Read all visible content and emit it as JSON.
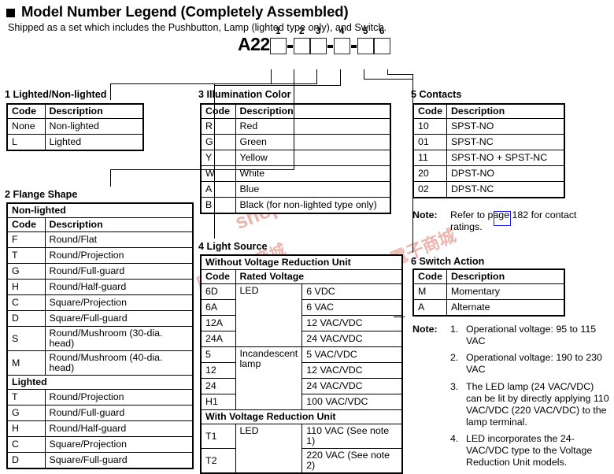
{
  "header": {
    "title": "Model Number Legend (Completely Assembled)",
    "subtitle": "Shipped as a set which includes the Pushbutton, Lamp (lighted type only), and Switch."
  },
  "model_number": {
    "prefix": "A22",
    "dash": "-",
    "positions": [
      "1",
      "2",
      "3",
      "4",
      "5",
      "6"
    ]
  },
  "watermark": {
    "line1": "shop.cpu.com.tw",
    "line2": "shop.cpu.com.tw",
    "line3": "康華電子商城",
    "line4": "康華電子商城"
  },
  "sections": {
    "s1": {
      "title": "1 Lighted/Non-lighted",
      "headers": [
        "Code",
        "Description"
      ],
      "rows": [
        [
          "None",
          "Non-lighted"
        ],
        [
          "L",
          "Lighted"
        ]
      ]
    },
    "s2": {
      "title": "2 Flange Shape",
      "group1": "Non-lighted",
      "headers": [
        "Code",
        "Description"
      ],
      "rows_nonlighted": [
        [
          "F",
          "Round/Flat"
        ],
        [
          "T",
          "Round/Projection"
        ],
        [
          "G",
          "Round/Full-guard"
        ],
        [
          "H",
          "Round/Half-guard"
        ],
        [
          "C",
          "Square/Projection"
        ],
        [
          "D",
          "Square/Full-guard"
        ],
        [
          "S",
          "Round/Mushroom (30-dia. head)"
        ],
        [
          "M",
          "Round/Mushroom (40-dia. head)"
        ]
      ],
      "group2": "Lighted",
      "rows_lighted": [
        [
          "T",
          "Round/Projection"
        ],
        [
          "G",
          "Round/Full-guard"
        ],
        [
          "H",
          "Round/Half-guard"
        ],
        [
          "C",
          "Square/Projection"
        ],
        [
          "D",
          "Square/Full-guard"
        ]
      ]
    },
    "s3": {
      "title": "3 Illumination Color",
      "headers": [
        "Code",
        "Description"
      ],
      "rows": [
        [
          "R",
          "Red"
        ],
        [
          "G",
          "Green"
        ],
        [
          "Y",
          "Yellow"
        ],
        [
          "W",
          "White"
        ],
        [
          "A",
          "Blue"
        ],
        [
          "B",
          "Black (for non-lighted type only)"
        ]
      ]
    },
    "s4": {
      "title": "4 Light Source",
      "group1": "Without Voltage Reduction Unit",
      "headers": [
        "Code",
        "Rated Voltage"
      ],
      "rows_without": [
        [
          "6D",
          "LED",
          "6 VDC"
        ],
        [
          "6A",
          "",
          "6 VAC"
        ],
        [
          "12A",
          "",
          "12 VAC/VDC"
        ],
        [
          "24A",
          "",
          "24 VAC/VDC"
        ],
        [
          "5",
          "Incandescent lamp",
          "5 VAC/VDC"
        ],
        [
          "12",
          "",
          "12 VAC/VDC"
        ],
        [
          "24",
          "",
          "24 VAC/VDC"
        ],
        [
          "H1",
          "",
          "100 VAC/VDC"
        ]
      ],
      "group2": "With Voltage Reduction Unit",
      "rows_with": [
        [
          "T1",
          "LED",
          "110 VAC (See note 1)"
        ],
        [
          "T2",
          "",
          "220 VAC (See note 2)"
        ]
      ]
    },
    "s5": {
      "title": "5 Contacts",
      "headers": [
        "Code",
        "Description"
      ],
      "rows": [
        [
          "10",
          "SPST-NO"
        ],
        [
          "01",
          "SPST-NC"
        ],
        [
          "11",
          "SPST-NO + SPST-NC"
        ],
        [
          "20",
          "DPST-NO"
        ],
        [
          "02",
          "DPST-NC"
        ]
      ],
      "note_label": "Note:",
      "note_text": "Refer to page 182 for contact ratings."
    },
    "s6": {
      "title": "6 Switch Action",
      "headers": [
        "Code",
        "Description"
      ],
      "rows": [
        [
          "M",
          "Momentary"
        ],
        [
          "A",
          "Alternate"
        ]
      ],
      "note_label": "Note:",
      "notes": [
        {
          "num": "1.",
          "text": "Operational voltage: 95 to 115 VAC"
        },
        {
          "num": "2.",
          "text": "Operational voltage: 190 to 230 VAC"
        },
        {
          "num": "3.",
          "text": "The LED lamp (24 VAC/VDC) can be lit by directly applying 110 VAC/VDC (220 VAC/VDC) to the lamp terminal."
        },
        {
          "num": "4.",
          "text": "LED incorporates the 24-VAC/VDC type to the Voltage Reduction Unit models."
        }
      ]
    }
  },
  "colors": {
    "ink": "#000000",
    "watermark": "#e8a9a0",
    "annotation": "#1a1ae0"
  }
}
